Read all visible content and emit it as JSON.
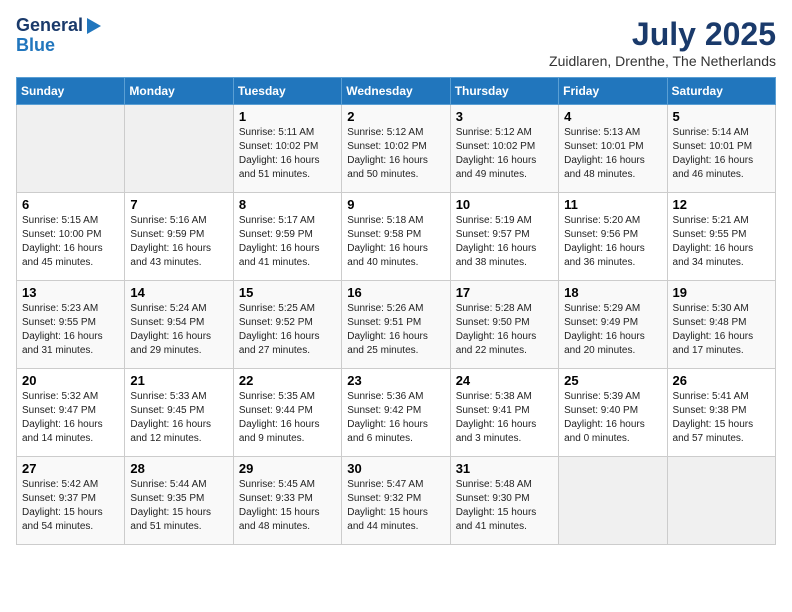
{
  "logo": {
    "line1": "General",
    "line2": "Blue"
  },
  "header": {
    "month": "July 2025",
    "location": "Zuidlaren, Drenthe, The Netherlands"
  },
  "weekdays": [
    "Sunday",
    "Monday",
    "Tuesday",
    "Wednesday",
    "Thursday",
    "Friday",
    "Saturday"
  ],
  "weeks": [
    [
      {
        "day": "",
        "info": ""
      },
      {
        "day": "",
        "info": ""
      },
      {
        "day": "1",
        "info": "Sunrise: 5:11 AM\nSunset: 10:02 PM\nDaylight: 16 hours\nand 51 minutes."
      },
      {
        "day": "2",
        "info": "Sunrise: 5:12 AM\nSunset: 10:02 PM\nDaylight: 16 hours\nand 50 minutes."
      },
      {
        "day": "3",
        "info": "Sunrise: 5:12 AM\nSunset: 10:02 PM\nDaylight: 16 hours\nand 49 minutes."
      },
      {
        "day": "4",
        "info": "Sunrise: 5:13 AM\nSunset: 10:01 PM\nDaylight: 16 hours\nand 48 minutes."
      },
      {
        "day": "5",
        "info": "Sunrise: 5:14 AM\nSunset: 10:01 PM\nDaylight: 16 hours\nand 46 minutes."
      }
    ],
    [
      {
        "day": "6",
        "info": "Sunrise: 5:15 AM\nSunset: 10:00 PM\nDaylight: 16 hours\nand 45 minutes."
      },
      {
        "day": "7",
        "info": "Sunrise: 5:16 AM\nSunset: 9:59 PM\nDaylight: 16 hours\nand 43 minutes."
      },
      {
        "day": "8",
        "info": "Sunrise: 5:17 AM\nSunset: 9:59 PM\nDaylight: 16 hours\nand 41 minutes."
      },
      {
        "day": "9",
        "info": "Sunrise: 5:18 AM\nSunset: 9:58 PM\nDaylight: 16 hours\nand 40 minutes."
      },
      {
        "day": "10",
        "info": "Sunrise: 5:19 AM\nSunset: 9:57 PM\nDaylight: 16 hours\nand 38 minutes."
      },
      {
        "day": "11",
        "info": "Sunrise: 5:20 AM\nSunset: 9:56 PM\nDaylight: 16 hours\nand 36 minutes."
      },
      {
        "day": "12",
        "info": "Sunrise: 5:21 AM\nSunset: 9:55 PM\nDaylight: 16 hours\nand 34 minutes."
      }
    ],
    [
      {
        "day": "13",
        "info": "Sunrise: 5:23 AM\nSunset: 9:55 PM\nDaylight: 16 hours\nand 31 minutes."
      },
      {
        "day": "14",
        "info": "Sunrise: 5:24 AM\nSunset: 9:54 PM\nDaylight: 16 hours\nand 29 minutes."
      },
      {
        "day": "15",
        "info": "Sunrise: 5:25 AM\nSunset: 9:52 PM\nDaylight: 16 hours\nand 27 minutes."
      },
      {
        "day": "16",
        "info": "Sunrise: 5:26 AM\nSunset: 9:51 PM\nDaylight: 16 hours\nand 25 minutes."
      },
      {
        "day": "17",
        "info": "Sunrise: 5:28 AM\nSunset: 9:50 PM\nDaylight: 16 hours\nand 22 minutes."
      },
      {
        "day": "18",
        "info": "Sunrise: 5:29 AM\nSunset: 9:49 PM\nDaylight: 16 hours\nand 20 minutes."
      },
      {
        "day": "19",
        "info": "Sunrise: 5:30 AM\nSunset: 9:48 PM\nDaylight: 16 hours\nand 17 minutes."
      }
    ],
    [
      {
        "day": "20",
        "info": "Sunrise: 5:32 AM\nSunset: 9:47 PM\nDaylight: 16 hours\nand 14 minutes."
      },
      {
        "day": "21",
        "info": "Sunrise: 5:33 AM\nSunset: 9:45 PM\nDaylight: 16 hours\nand 12 minutes."
      },
      {
        "day": "22",
        "info": "Sunrise: 5:35 AM\nSunset: 9:44 PM\nDaylight: 16 hours\nand 9 minutes."
      },
      {
        "day": "23",
        "info": "Sunrise: 5:36 AM\nSunset: 9:42 PM\nDaylight: 16 hours\nand 6 minutes."
      },
      {
        "day": "24",
        "info": "Sunrise: 5:38 AM\nSunset: 9:41 PM\nDaylight: 16 hours\nand 3 minutes."
      },
      {
        "day": "25",
        "info": "Sunrise: 5:39 AM\nSunset: 9:40 PM\nDaylight: 16 hours\nand 0 minutes."
      },
      {
        "day": "26",
        "info": "Sunrise: 5:41 AM\nSunset: 9:38 PM\nDaylight: 15 hours\nand 57 minutes."
      }
    ],
    [
      {
        "day": "27",
        "info": "Sunrise: 5:42 AM\nSunset: 9:37 PM\nDaylight: 15 hours\nand 54 minutes."
      },
      {
        "day": "28",
        "info": "Sunrise: 5:44 AM\nSunset: 9:35 PM\nDaylight: 15 hours\nand 51 minutes."
      },
      {
        "day": "29",
        "info": "Sunrise: 5:45 AM\nSunset: 9:33 PM\nDaylight: 15 hours\nand 48 minutes."
      },
      {
        "day": "30",
        "info": "Sunrise: 5:47 AM\nSunset: 9:32 PM\nDaylight: 15 hours\nand 44 minutes."
      },
      {
        "day": "31",
        "info": "Sunrise: 5:48 AM\nSunset: 9:30 PM\nDaylight: 15 hours\nand 41 minutes."
      },
      {
        "day": "",
        "info": ""
      },
      {
        "day": "",
        "info": ""
      }
    ]
  ]
}
